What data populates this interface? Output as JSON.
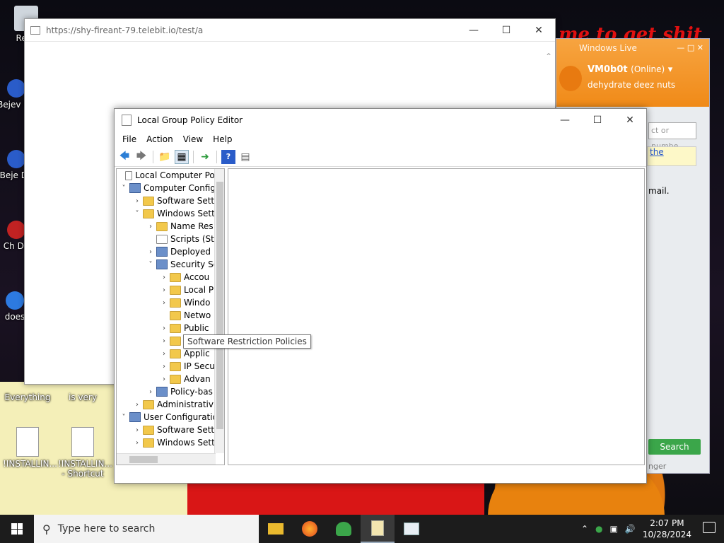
{
  "desktop": {
    "icons": [
      {
        "label": "Recy"
      },
      {
        "label": "Bejev De"
      },
      {
        "label": "Beje De"
      },
      {
        "label": "Ch De"
      },
      {
        "label": "does"
      },
      {
        "label": "Everything"
      },
      {
        "label": "is very"
      },
      {
        "label": "!INSTALLIN..."
      },
      {
        "label": "!INSTALLIN... - Shortcut"
      }
    ]
  },
  "browser": {
    "url": "https://shy-fireant-79.telebit.io/test/a"
  },
  "messenger": {
    "title": "Windows Live",
    "username": "VM0b0t",
    "status": "(Online)",
    "mood": "dehydrate deez nuts",
    "search_placeholder": "ct or numbe",
    "link_text": "the",
    "mail_text": "mail.",
    "search_button": "Search",
    "footer_text": "nger"
  },
  "gpedit": {
    "title": "Local Group Policy Editor",
    "menu": [
      "File",
      "Action",
      "View",
      "Help"
    ],
    "tree": [
      {
        "label": "Local Computer Polic",
        "indent": 0,
        "chev": "",
        "icon": "doc"
      },
      {
        "label": "Computer Config",
        "indent": 0,
        "chev": "v",
        "icon": "comp"
      },
      {
        "label": "Software Setti",
        "indent": 1,
        "chev": ">",
        "icon": "fold"
      },
      {
        "label": "Windows Sett",
        "indent": 1,
        "chev": "v",
        "icon": "fold"
      },
      {
        "label": "Name Res",
        "indent": 2,
        "chev": ">",
        "icon": "fold"
      },
      {
        "label": "Scripts (Sta",
        "indent": 2,
        "chev": "",
        "icon": "doc"
      },
      {
        "label": "Deployed",
        "indent": 2,
        "chev": ">",
        "icon": "comp"
      },
      {
        "label": "Security Se",
        "indent": 2,
        "chev": "v",
        "icon": "comp"
      },
      {
        "label": "Accou",
        "indent": 3,
        "chev": ">",
        "icon": "fold"
      },
      {
        "label": "Local P",
        "indent": 3,
        "chev": ">",
        "icon": "fold"
      },
      {
        "label": "Windo",
        "indent": 3,
        "chev": ">",
        "icon": "fold"
      },
      {
        "label": "Netwo",
        "indent": 3,
        "chev": "",
        "icon": "fold"
      },
      {
        "label": "Public",
        "indent": 3,
        "chev": ">",
        "icon": "fold"
      },
      {
        "label": "",
        "indent": 3,
        "chev": ">",
        "icon": "fold"
      },
      {
        "label": "Applic",
        "indent": 3,
        "chev": ">",
        "icon": "fold"
      },
      {
        "label": "IP Secu",
        "indent": 3,
        "chev": ">",
        "icon": "fold"
      },
      {
        "label": "Advan",
        "indent": 3,
        "chev": ">",
        "icon": "fold"
      },
      {
        "label": "Policy-bas",
        "indent": 2,
        "chev": ">",
        "icon": "comp"
      },
      {
        "label": "Administrativ",
        "indent": 1,
        "chev": ">",
        "icon": "fold"
      },
      {
        "label": "User Configuratio",
        "indent": 0,
        "chev": "v",
        "icon": "comp"
      },
      {
        "label": "Software Setti",
        "indent": 1,
        "chev": ">",
        "icon": "fold"
      },
      {
        "label": "Windows Sett",
        "indent": 1,
        "chev": ">",
        "icon": "fold"
      }
    ],
    "tooltip": "Software Restriction Policies"
  },
  "taskbar": {
    "search_placeholder": "Type here to search",
    "time": "2:07 PM",
    "date": "10/28/2024"
  }
}
